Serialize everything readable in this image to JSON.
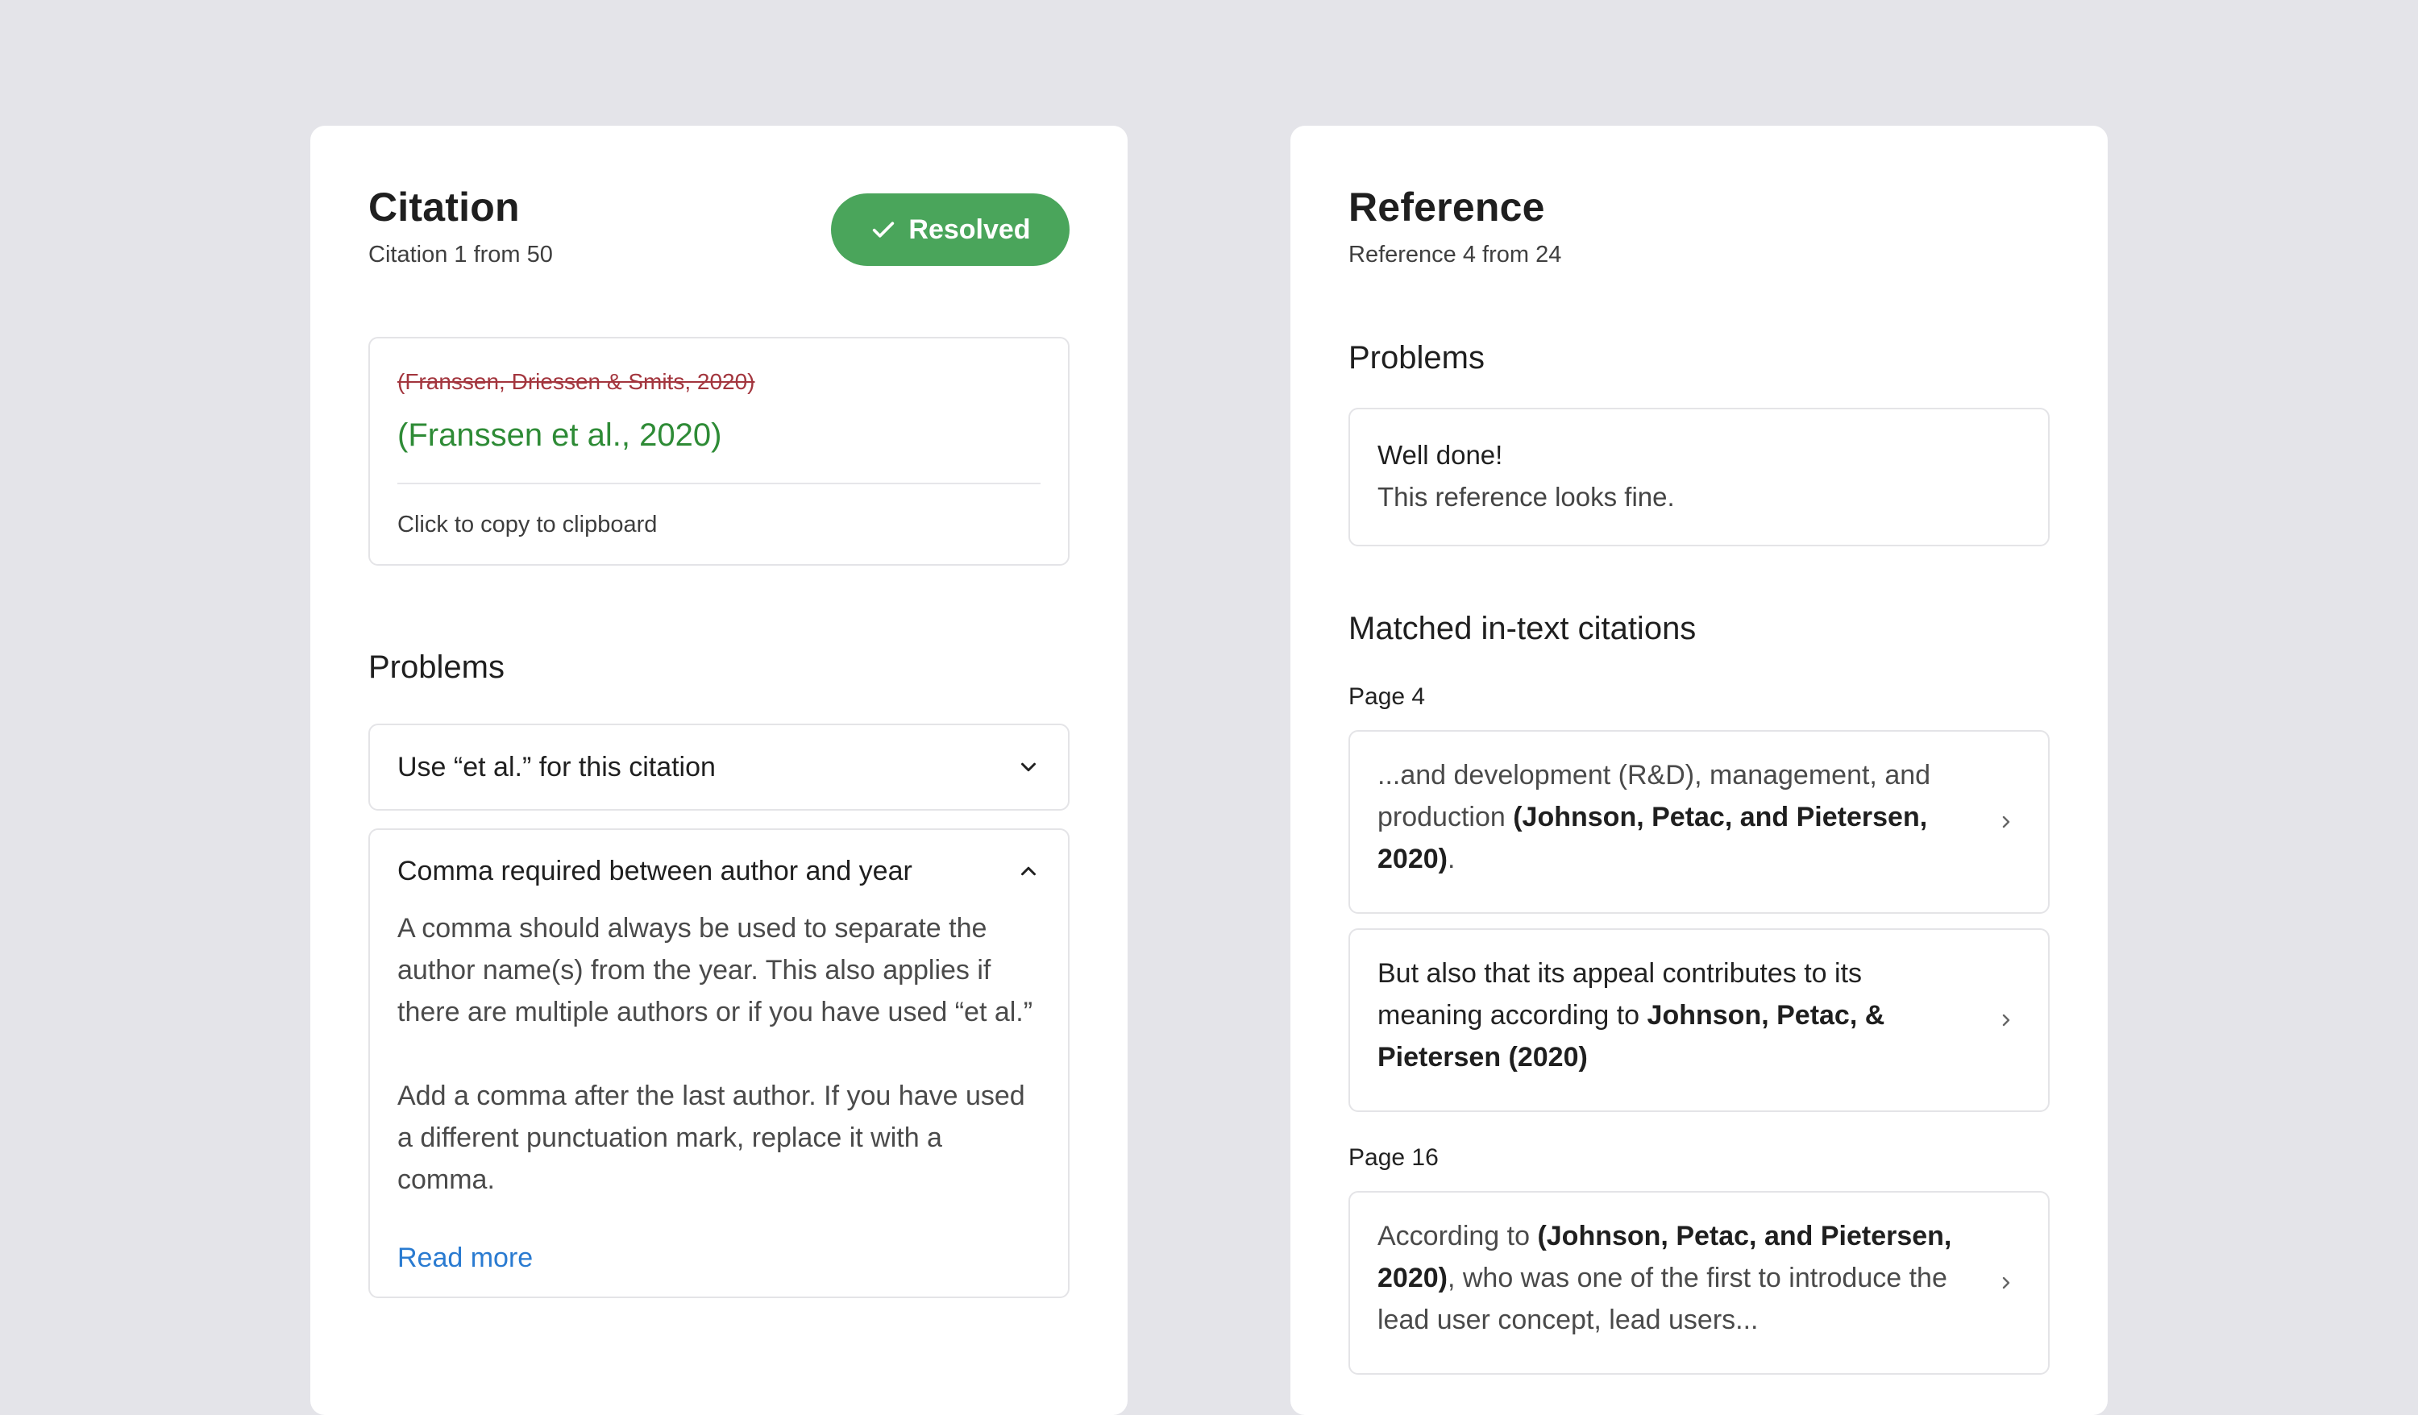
{
  "citation": {
    "title": "Citation",
    "subtitle": "Citation 1 from 50",
    "status_label": "Resolved",
    "original": "(Franssen, Driessen & Smits, 2020)",
    "corrected": "(Franssen et al., 2020)",
    "copy_hint": "Click to copy to clipboard",
    "problems_title": "Problems",
    "problems": [
      {
        "title": "Use “et al.” for this citation",
        "expanded": false
      },
      {
        "title": "Comma required between author and year",
        "expanded": true,
        "body": [
          "A comma should always be used to separate the author name(s) from the year. This also applies if there are multiple authors or if you have used “et al.”",
          "Add a comma after the last author. If you have used a different punctuation mark, replace it with a comma."
        ],
        "link": "Read more"
      }
    ]
  },
  "reference": {
    "title": "Reference",
    "subtitle": "Reference 4 from 24",
    "problems_title": "Problems",
    "status_heading": "Well done!",
    "status_message": "This reference looks fine.",
    "matched_title": "Matched in-text citations",
    "pages": [
      {
        "label": "Page 4",
        "items": [
          {
            "pre": "...and development (R&D), management, and production ",
            "bold": "(Johnson, Petac, and Pietersen, 2020)",
            "post": "."
          },
          {
            "pre": "But also that its appeal contributes to its meaning according to ",
            "bold": "Johnson, Petac, & Pietersen (2020)",
            "post": ""
          }
        ]
      },
      {
        "label": "Page 16",
        "items": [
          {
            "pre": "According to ",
            "bold": "(Johnson, Petac, and Pietersen, 2020)",
            "post": ", who was one of the first to introduce the lead user concept, lead users..."
          }
        ]
      }
    ]
  },
  "colors": {
    "accent_success": "#4aa55b",
    "strike": "#a3363e",
    "corrected": "#2e8b36",
    "link": "#2a7bd1",
    "background": "#e4e4e9"
  },
  "icons": {
    "status": "checkmark-icon",
    "collapsed": "chevron-down-icon",
    "expanded": "chevron-up-icon",
    "citation_item": "chevron-right-icon"
  }
}
